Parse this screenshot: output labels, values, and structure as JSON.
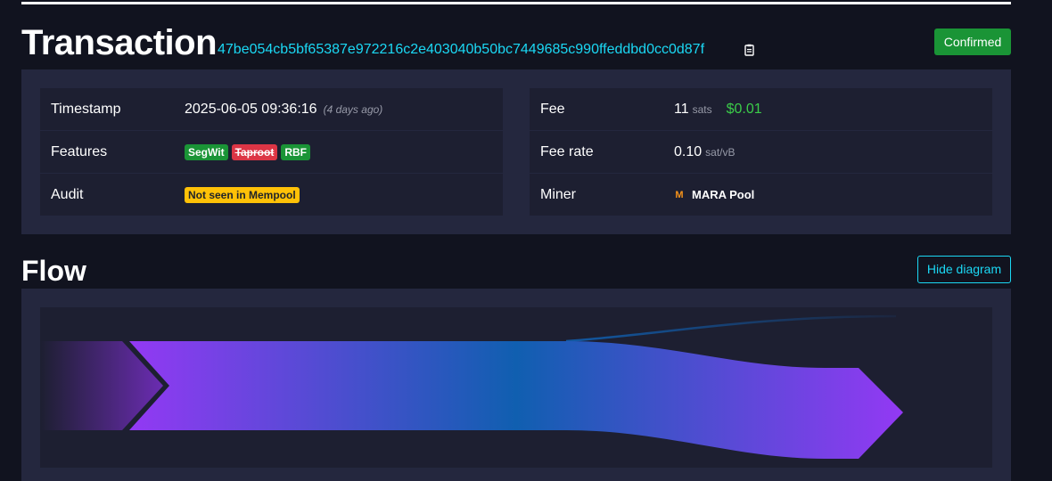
{
  "header": {
    "title": "Transaction",
    "txid": "47be054cb5bf65387e972216c2e403040b50bc7449685c990ffeddbd0cc0d87f",
    "status": "Confirmed"
  },
  "details": {
    "timestamp": {
      "label": "Timestamp",
      "value": "2025-06-05 09:36:16",
      "ago": "(4 days ago)"
    },
    "features": {
      "label": "Features",
      "badges": [
        "SegWit",
        "Taproot",
        "RBF"
      ]
    },
    "audit": {
      "label": "Audit",
      "value": "Not seen in Mempool"
    },
    "fee": {
      "label": "Fee",
      "value": "11",
      "unit": "sats",
      "usd": "$0.01"
    },
    "fee_rate": {
      "label": "Fee rate",
      "value": "0.10",
      "unit": "sat/vB"
    },
    "miner": {
      "label": "Miner",
      "logo": "M",
      "name": "MARA Pool"
    }
  },
  "flow": {
    "title": "Flow",
    "toggle_label": "Hide diagram"
  },
  "colors": {
    "accent": "#1bd8f4",
    "confirmed": "#1a9436",
    "purple": "#9339f4",
    "blue": "#105fb0",
    "background": "#11131f",
    "panel": "#24273e"
  }
}
